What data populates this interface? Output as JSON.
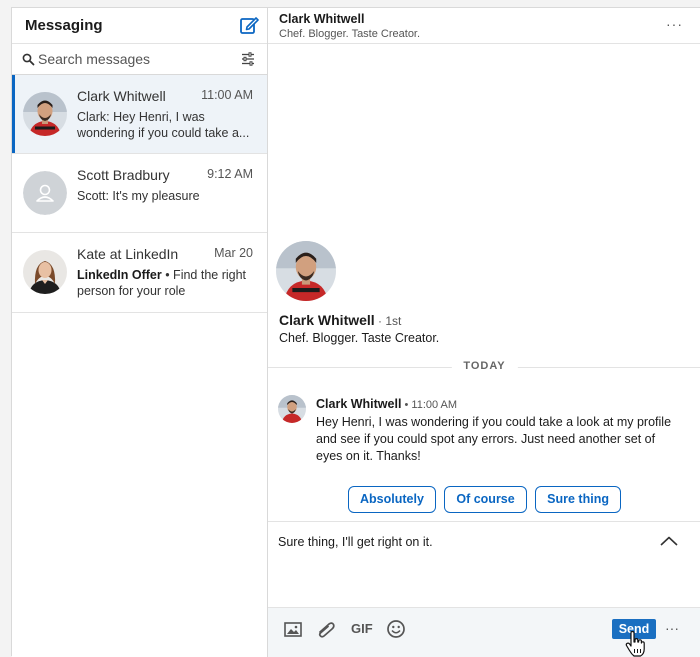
{
  "sidebar": {
    "title": "Messaging",
    "search_placeholder": "Search messages",
    "conversations": [
      {
        "name": "Clark Whitwell",
        "time": "11:00 AM",
        "snippet": "Clark: Hey Henri, I was wondering if you could take a...",
        "active": true
      },
      {
        "name": "Scott Bradbury",
        "time": "9:12 AM",
        "snippet": "Scott: It's my pleasure",
        "active": false
      },
      {
        "name": "Kate at LinkedIn",
        "time": "Mar 20",
        "snippet_bold": "LinkedIn Offer",
        "snippet": " • Find the right person for your role",
        "active": false
      }
    ]
  },
  "thread": {
    "header_name": "Clark Whitwell",
    "header_headline": "Chef. Blogger. Taste Creator.",
    "more": "···",
    "profile": {
      "name": "Clark Whitwell",
      "degree": " · 1st",
      "headline": "Chef. Blogger. Taste Creator."
    },
    "divider_label": "TODAY",
    "message": {
      "sender": "Clark Whitwell",
      "time": " • 11:00 AM",
      "text": "Hey Henri, I was wondering if you could take a look at my profile and see if you could spot any errors. Just need another set of eyes on it. Thanks!"
    },
    "smart_replies": [
      "Absolutely",
      "Of course",
      "Sure thing"
    ],
    "compose_text": "Sure thing, I'll get right on it.",
    "toolbar": {
      "gif": "GIF",
      "send": "Send",
      "more": "···"
    }
  },
  "colors": {
    "accent": "#0a66c2",
    "send_bg": "#1a6fc1",
    "active_bg": "#eef3f8"
  }
}
